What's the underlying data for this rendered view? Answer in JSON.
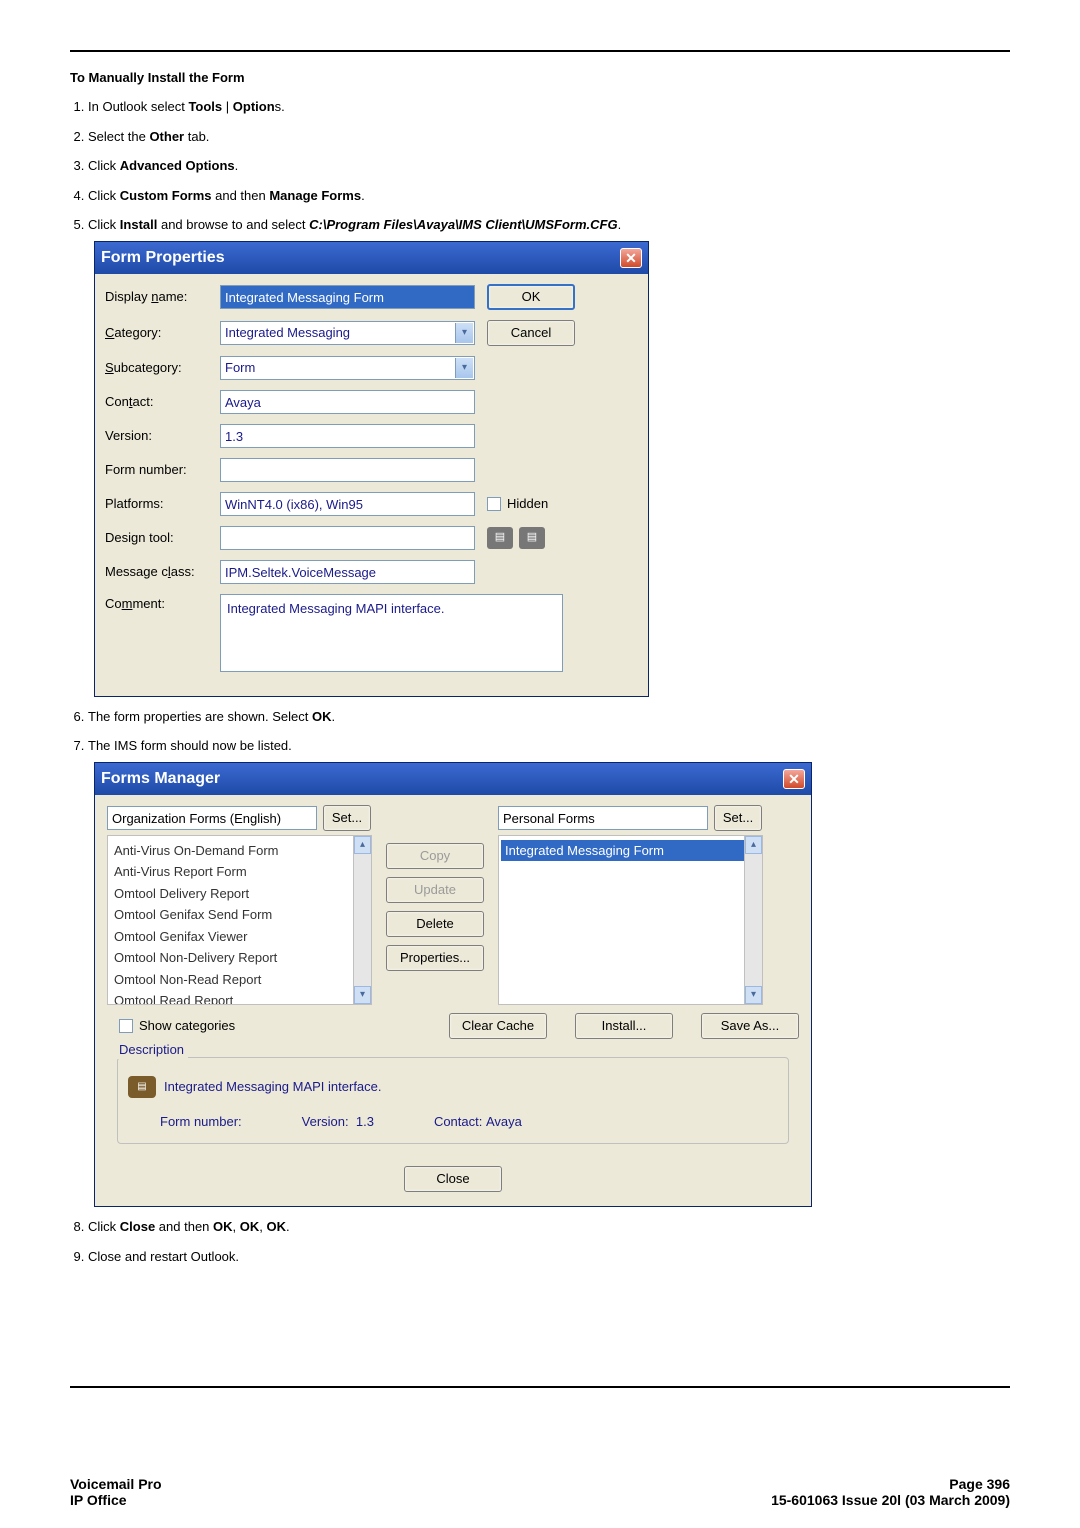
{
  "doc": {
    "section_title": "To Manually Install the Form",
    "step1_a": "In Outlook select ",
    "step1_b1": "Tools",
    "step1_sep": " | ",
    "step1_b2": "Option",
    "step1_c": "s.",
    "step2_a": "Select the ",
    "step2_b": "Other",
    "step2_c": " tab.",
    "step3_a": "Click ",
    "step3_b": "Advanced Options",
    "step3_c": ".",
    "step4_a": "Click ",
    "step4_b1": "Custom Forms",
    "step4_mid": " and then ",
    "step4_b2": "Manage Forms",
    "step4_c": ".",
    "step5_a": "Click ",
    "step5_b": "Install",
    "step5_mid": " and browse to and select ",
    "step5_path": "C:\\Program Files\\Avaya\\IMS Client\\UMSForm.CFG",
    "step5_c": ".",
    "step6_a": "The form properties are shown. Select ",
    "step6_b": "OK",
    "step6_c": ".",
    "step7": "The IMS form should now be listed.",
    "step8_a": "Click ",
    "step8_b1": "Close",
    "step8_mid1": " and then ",
    "step8_b2": "OK",
    "step8_mid2": ", ",
    "step8_b3": "OK",
    "step8_mid3": ", ",
    "step8_b4": "OK",
    "step8_c": ".",
    "step9": "Close and restart Outlook."
  },
  "fp": {
    "title": "Form Properties",
    "labels": {
      "display_name": "Display name:",
      "category": "Category:",
      "subcategory": "Subcategory:",
      "contact": "Contact:",
      "version": "Version:",
      "form_number": "Form number:",
      "platforms": "Platforms:",
      "design_tool": "Design tool:",
      "message_class": "Message class:",
      "comment": "Comment:"
    },
    "values": {
      "display_name": "Integrated Messaging Form",
      "category": "Integrated Messaging",
      "subcategory": "Form",
      "contact": "Avaya",
      "version": "1.3",
      "form_number": "",
      "platforms": "WinNT4.0 (ix86), Win95",
      "design_tool": "",
      "message_class": "IPM.Seltek.VoiceMessage",
      "comment": "Integrated Messaging MAPI interface."
    },
    "buttons": {
      "ok": "OK",
      "cancel": "Cancel",
      "hidden": "Hidden"
    }
  },
  "fm": {
    "title": "Forms Manager",
    "left_lib": "Organization Forms (English)",
    "right_lib": "Personal Forms",
    "set": "Set...",
    "left_items": [
      "Anti-Virus On-Demand Form",
      "Anti-Virus Report Form",
      "Omtool Delivery Report",
      "Omtool Genifax Send Form",
      "Omtool Genifax Viewer",
      "Omtool Non-Delivery Report",
      "Omtool Non-Read Report",
      "Omtool Read Report"
    ],
    "right_selected": "Integrated Messaging Form",
    "btns": {
      "copy": "Copy",
      "update": "Update",
      "delete": "Delete",
      "properties": "Properties...",
      "clear_cache": "Clear Cache",
      "install": "Install...",
      "save_as": "Save As...",
      "close": "Close"
    },
    "show_categories": "Show categories",
    "desc_legend": "Description",
    "desc_text": "Integrated Messaging MAPI interface.",
    "form_number_lbl": "Form number:",
    "version_lbl": "Version:",
    "version_val": "1.3",
    "contact_lbl": "Contact:",
    "contact_val": "Avaya"
  },
  "footer": {
    "left1": "Voicemail Pro",
    "left2": "IP Office",
    "right1": "Page 396",
    "right2": "15-601063 Issue 20l (03 March 2009)"
  }
}
